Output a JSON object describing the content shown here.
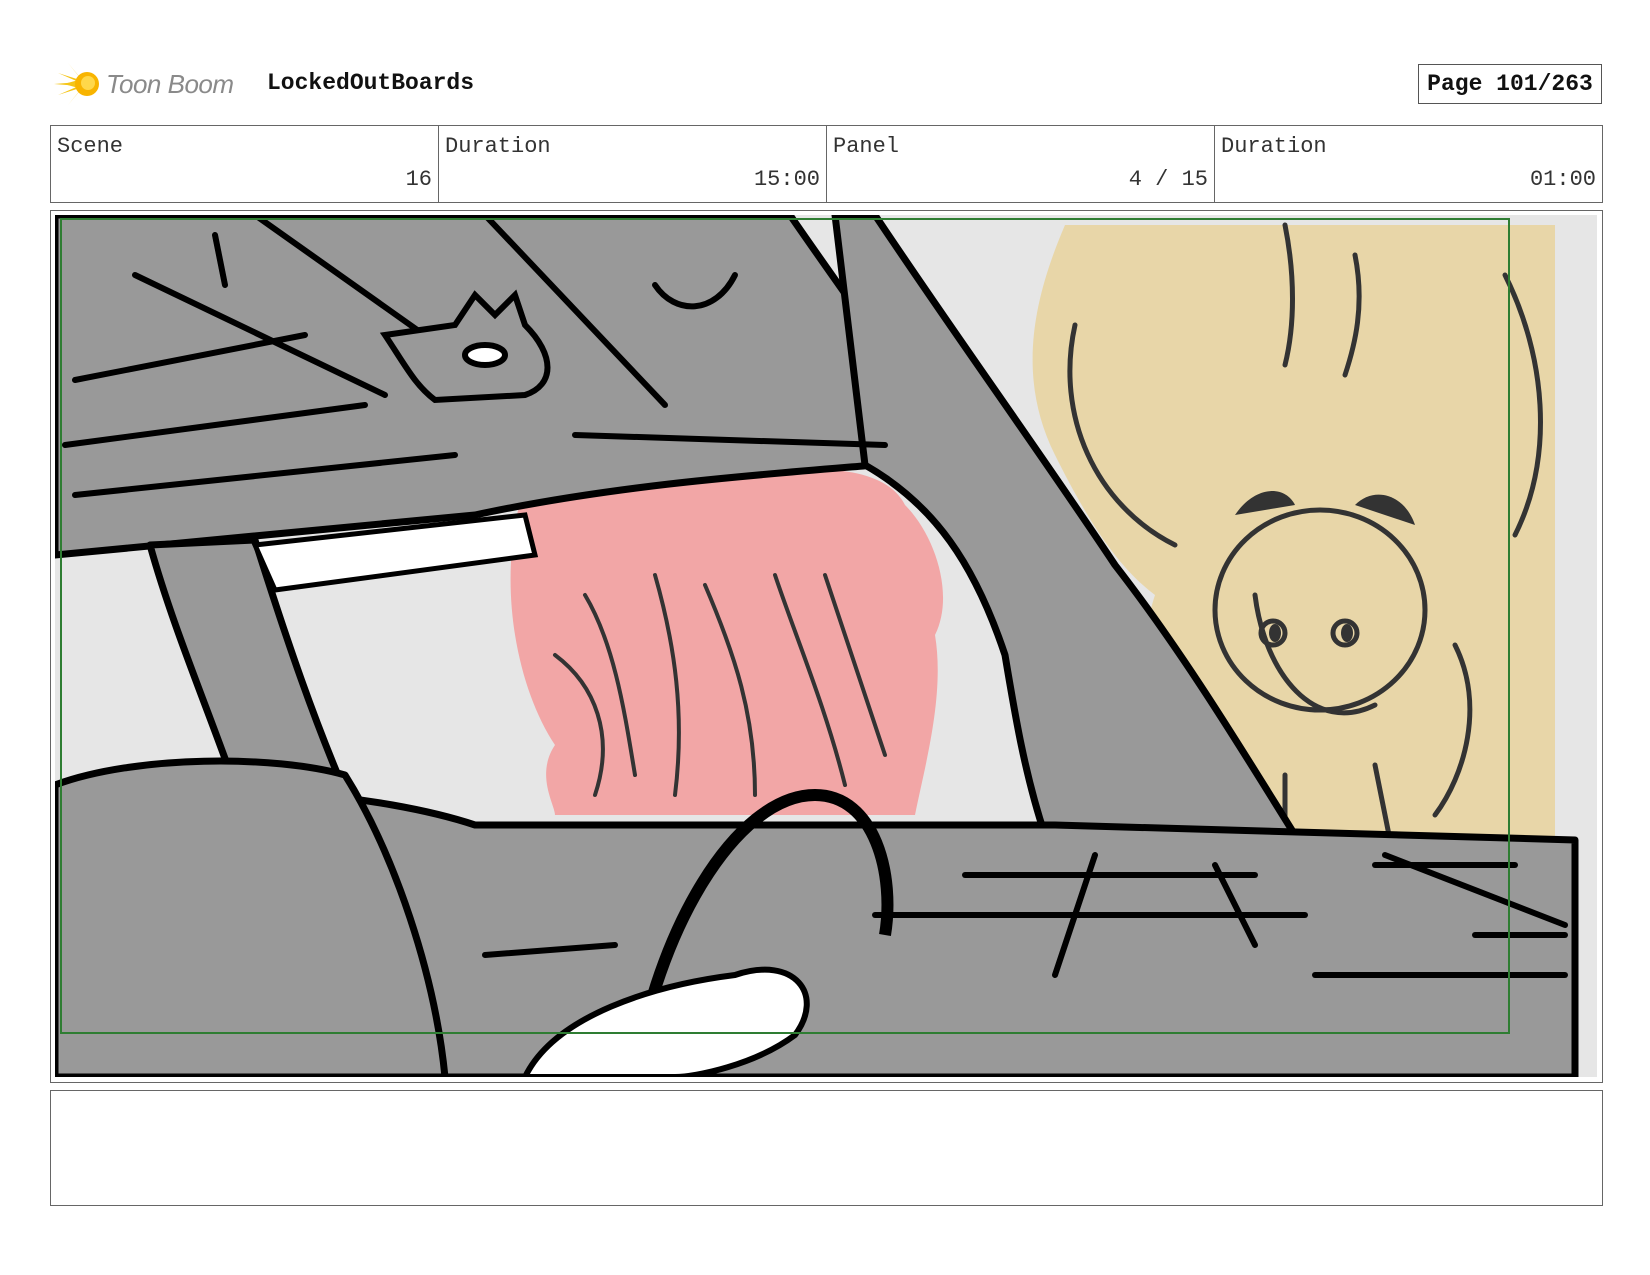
{
  "header": {
    "brand": "Toon Boom",
    "project": "LockedOutBoards",
    "page": "Page 101/263"
  },
  "info": {
    "scene_label": "Scene",
    "scene_value": "16",
    "scene_duration_label": "Duration",
    "scene_duration_value": "15:00",
    "panel_label": "Panel",
    "panel_value": "4 / 15",
    "panel_duration_label": "Duration",
    "panel_duration_value": "01:00"
  },
  "notes": "",
  "colors": {
    "car_gray": "#999999",
    "sky": "#e6e6e6",
    "pink_hair": "#f2a6a6",
    "tan_character": "#e8d6a8",
    "safe_frame": "#2e7d32",
    "logo_yellow": "#f5c518"
  }
}
